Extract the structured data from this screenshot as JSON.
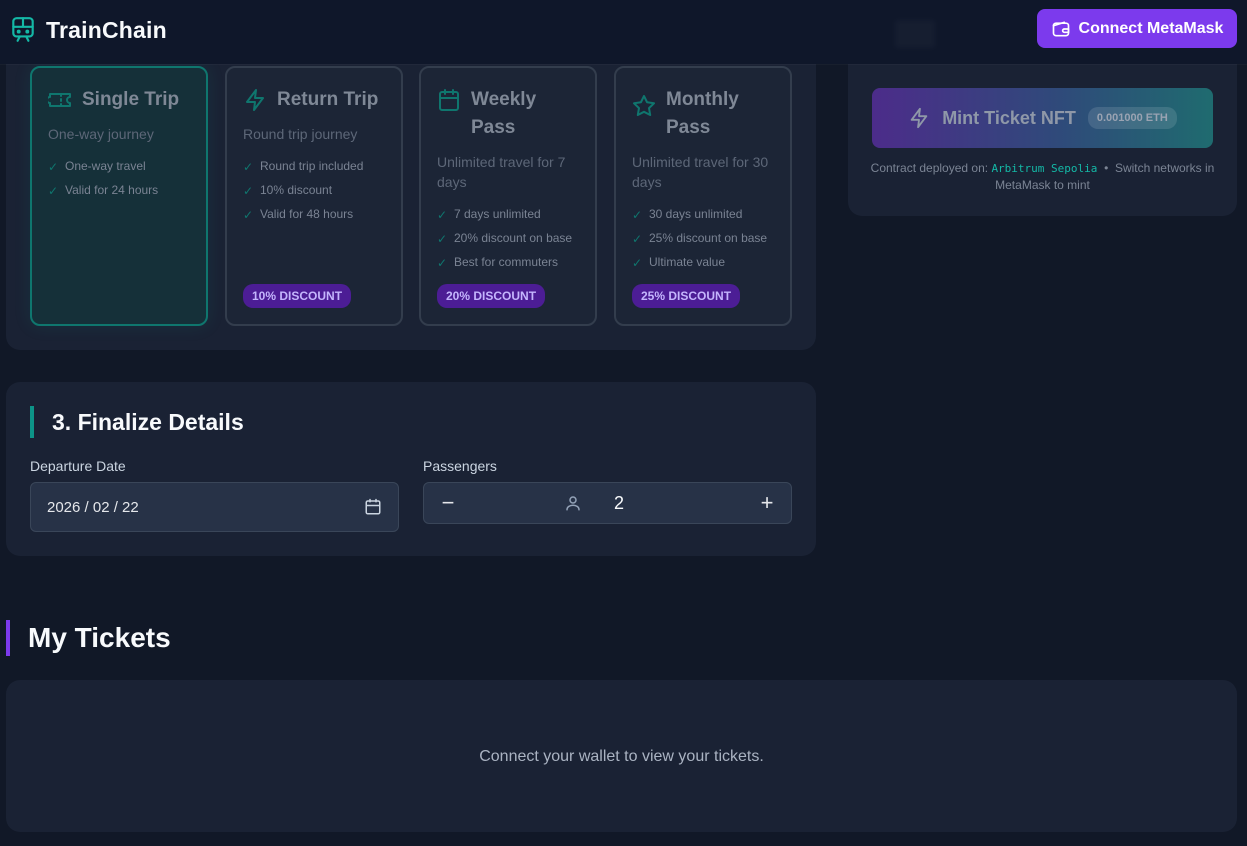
{
  "app": {
    "name": "TrainChain"
  },
  "header": {
    "connect_label": "Connect MetaMask"
  },
  "tickets": [
    {
      "title": "Single Trip",
      "subtitle": "One-way journey",
      "features": [
        "One-way travel",
        "Valid for 24 hours"
      ],
      "discount": "",
      "selected": true,
      "icon": "ticket-icon"
    },
    {
      "title": "Return Trip",
      "subtitle": "Round trip journey",
      "features": [
        "Round trip included",
        "10% discount",
        "Valid for 48 hours"
      ],
      "discount": "10% DISCOUNT",
      "selected": false,
      "icon": "lightning-icon"
    },
    {
      "title": "Weekly Pass",
      "subtitle": "Unlimited travel for 7 days",
      "features": [
        "7 days unlimited",
        "20% discount on base",
        "Best for commuters"
      ],
      "discount": "20% DISCOUNT",
      "selected": false,
      "icon": "calendar-icon"
    },
    {
      "title": "Monthly Pass",
      "subtitle": "Unlimited travel for 30 days",
      "features": [
        "30 days unlimited",
        "25% discount on base",
        "Ultimate value"
      ],
      "discount": "25% DISCOUNT",
      "selected": false,
      "icon": "star-icon"
    }
  ],
  "mint": {
    "button_label": "Mint Ticket NFT",
    "price": "0.001000 ETH",
    "note_prefix": "Contract deployed on:",
    "network": "Arbitrum Sepolia",
    "separator": "•",
    "note_suffix": "Switch networks in MetaMask to mint"
  },
  "details": {
    "title": "3. Finalize Details",
    "departure_label": "Departure Date",
    "departure_value": "2026 / 02 / 22",
    "passengers_label": "Passengers",
    "passengers_value": "2",
    "minus": "−",
    "plus": "+"
  },
  "my_tickets": {
    "title": "My Tickets",
    "empty_message": "Connect your wallet to view your tickets."
  },
  "colors": {
    "accent_purple": "#7c3aed",
    "accent_teal": "#14b8a6",
    "background": "#111827",
    "panel": "#1a2234"
  }
}
